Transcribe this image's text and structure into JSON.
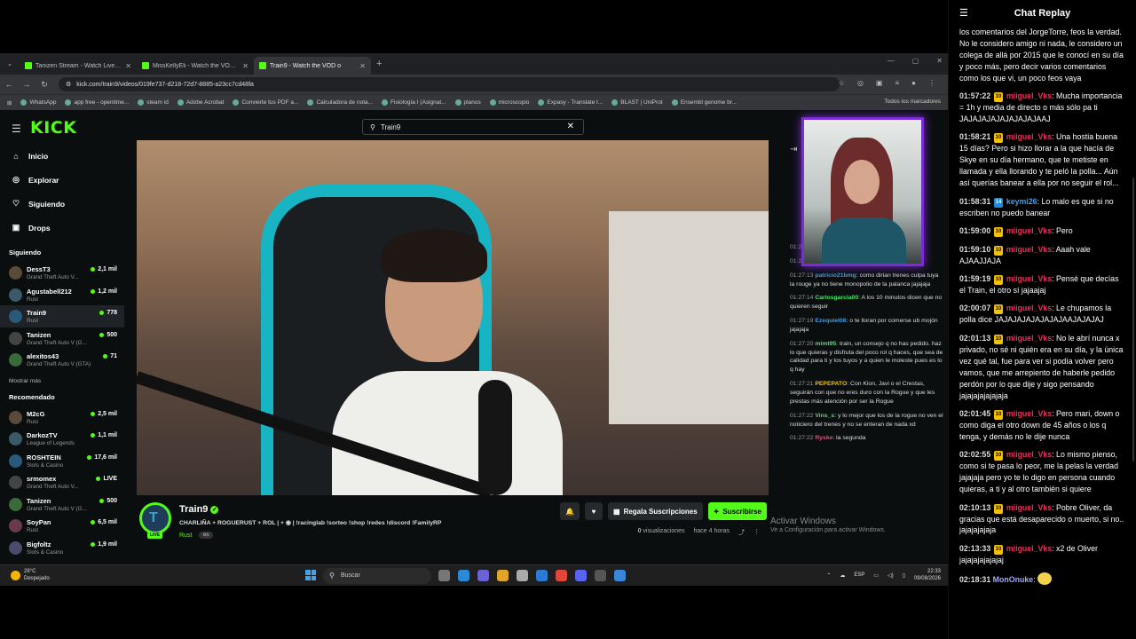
{
  "browser": {
    "tabs": [
      {
        "title": "Tanizen Stream - Watch Live on",
        "active": false
      },
      {
        "title": "MissKellyEli - Watch the VOD o",
        "active": false
      },
      {
        "title": "Train9 - Watch the VOD o",
        "active": true
      }
    ],
    "url": "kick.com/train9/videos/019fe737-d218-72d7-8885-a23cc7cd48fa",
    "bookmarks": [
      "WhatsApp",
      "app free - opentime...",
      "steam id",
      "Adobe Acrobat",
      "Convierte tus PDF a...",
      "Calculadora de nota...",
      "Fisiología I (Asignat...",
      "planos",
      "microscopio",
      "Expasy - Translate t...",
      "BLAST | UniProt",
      "Ensembl genome br..."
    ],
    "bookmarks_right": "Todos los marcadores"
  },
  "kick": {
    "logo": "KICK",
    "search_value": "Train9",
    "nav": [
      {
        "label": "Inicio",
        "icon": "home-icon"
      },
      {
        "label": "Explorar",
        "icon": "compass-icon"
      },
      {
        "label": "Siguiendo",
        "icon": "heart-icon"
      },
      {
        "label": "Drops",
        "icon": "gift-icon"
      }
    ],
    "following_title": "Siguiendo",
    "following": [
      {
        "name": "DessT3",
        "game": "Grand Theft Auto V...",
        "viewers": "2,1 mil"
      },
      {
        "name": "Agustabell212",
        "game": "Rust",
        "viewers": "1,2 mil"
      },
      {
        "name": "Train9",
        "game": "Rust",
        "viewers": "778"
      },
      {
        "name": "Tanizen",
        "game": "Grand Theft Auto V (G...",
        "viewers": "500"
      },
      {
        "name": "alexitos43",
        "game": "Grand Theft Auto V (GTA)",
        "viewers": "71"
      }
    ],
    "show_more": "Mostrar más",
    "recommended_title": "Recomendado",
    "recommended": [
      {
        "name": "M2cG",
        "game": "Rust",
        "viewers": "2,5 mil"
      },
      {
        "name": "DarkozTV",
        "game": "League of Legends",
        "viewers": "1,1 mil"
      },
      {
        "name": "ROSHTEIN",
        "game": "Slots & Casino",
        "viewers": "17,6 mil"
      },
      {
        "name": "srmomex",
        "game": "Grand Theft Auto V...",
        "viewers": "LIVE"
      },
      {
        "name": "Tanizen",
        "game": "Grand Theft Auto V (G...",
        "viewers": "500"
      },
      {
        "name": "SoyPan",
        "game": "Rust",
        "viewers": "6,5 mil"
      },
      {
        "name": "Bigfoltz",
        "game": "Slots & Casino",
        "viewers": "1,9 mil"
      }
    ],
    "channel": {
      "name": "Train9",
      "live_badge": "LIVE",
      "title": "CHARLIÑA + ROGUERUST + ROL | + ◉ | !racinglab !sorteo !shop !redes !discord !FamilyRP",
      "category": "Rust",
      "language": "es",
      "gift_subs": "Regala Suscripciones",
      "subscribe": "Suscribirse",
      "views_count": "0",
      "views_label": "visualizaciones",
      "ago": "hace 4 horas"
    },
    "overlay_chat": [
      {
        "ts": "01:27:11",
        "user": "L3G3ND4R104510",
        "color": "#4de36b",
        "text": "no aguantan"
      },
      {
        "ts": "01:27:13",
        "user": "Sirobe",
        "color": "#e84f7a",
        "text": "Pos a mi me molaria la vrd"
      },
      {
        "ts": "01:27:13",
        "user": "patricio21bmg",
        "color": "#36a3e8",
        "text": "como dirian trenes culpa tuya la rouge ya no tiene monopolio de la palanca jajajaja"
      },
      {
        "ts": "01:27:14",
        "user": "Carlosgarcia00",
        "color": "#4de36b",
        "text": "A los 10 minutos dicen que no quieren seguir"
      },
      {
        "ts": "01:27:19",
        "user": "Ezequiel06",
        "color": "#36a3e8",
        "text": "o te lloran por comerse ub mojón jajajaja"
      },
      {
        "ts": "01:27:20",
        "user": "mimt95",
        "color": "#4de36b",
        "text": "train, un consejo q no has pedido. haz lo que quieras y disfruta del poco rol q haces, que sea de calidad para ti y los tuyos y a quien le moleste pues es lo q hay"
      },
      {
        "ts": "01:27:21",
        "user": "PEPEPATO",
        "color": "#f2c200",
        "text": "Con Kion, Javi o el Crestas, seguirán con que no eres duro con la Rogue y que les prestas más atención por ser la Rogue"
      },
      {
        "ts": "01:27:22",
        "user": "Vins_s",
        "color": "#4de36b",
        "text": "y lo mejor que los de la rogue no ven el noticiero del trenes y no se enteran de nada xd"
      },
      {
        "ts": "01:27:22",
        "user": "Ryske",
        "color": "#e84f7a",
        "text": "la segunda"
      }
    ],
    "watermark_title": "Activar Windows",
    "watermark_sub": "Ve a Configuración para activar Windows."
  },
  "taskbar": {
    "temp": "28°C",
    "weather": "Despejado",
    "search": "Buscar",
    "lang": "ESP",
    "time": "22:33",
    "date": "09/08/2026"
  },
  "chat_replay": {
    "title": "Chat Replay",
    "first_text": "los comentarios del JorgeTorre, feos la verdad. No le considero amigo ni nada, le considero un colega de allá por 2015 que le conocí en su día y poco más, pero decir varios comentarios como los que vi, un poco feos vaya",
    "messages": [
      {
        "ts": "01:57:22",
        "badge": "10",
        "user": "miiguel_Vks",
        "color": "#e8315c",
        "text": "Mucha importancia = 1h y media de directo o más sólo pa ti JAJAJAJAJAJAJAJAJAAJ"
      },
      {
        "ts": "01:58:21",
        "badge": "10",
        "user": "miiguel_Vks",
        "color": "#e8315c",
        "text": "Una hostia buena 15 días? Pero si hizo llorar a la que hacía de Skye en su día hermano, que te metiste en llamada y ella llorando y te peló la polla... Aún así querías banear a ella por no seguir el rol..."
      },
      {
        "ts": "01:58:31",
        "badge": "14",
        "user": "keymi26",
        "color": "#3aa0f0",
        "text": "Lo malo es que si no escriben no puedo banear"
      },
      {
        "ts": "01:59:00",
        "badge": "10",
        "user": "miiguel_Vks",
        "color": "#e8315c",
        "text": "Pero"
      },
      {
        "ts": "01:59:10",
        "badge": "10",
        "user": "miiguel_Vks",
        "color": "#e8315c",
        "text": "Aaah vale AJAAJJAJA"
      },
      {
        "ts": "01:59:19",
        "badge": "10",
        "user": "miiguel_Vks",
        "color": "#e8315c",
        "text": "Pensé que decías el Train, el otro sí jajaajaj"
      },
      {
        "ts": "02:00:07",
        "badge": "10",
        "user": "miiguel_Vks",
        "color": "#e8315c",
        "text": "Le chupamos la polla dice JAJAJAJAJAJAJAJAAJAJAJAJ"
      },
      {
        "ts": "02:01:13",
        "badge": "10",
        "user": "miiguel_Vks",
        "color": "#e8315c",
        "text": "No le abrí nunca x privado, no sé ni quién era en su día, y la única vez qué tal, fue para ver si podía volver pero vamos, que me arrepiento de haberle pedido perdón por lo que dije y sigo pensando jajajajajajajaja"
      },
      {
        "ts": "02:01:45",
        "badge": "10",
        "user": "miiguel_Vks",
        "color": "#e8315c",
        "text": "Pero mari, down o como diga el otro down de 45 años o los q tenga, y demás no le dije nunca"
      },
      {
        "ts": "02:02:55",
        "badge": "10",
        "user": "miiguel_Vks",
        "color": "#e8315c",
        "text": "Lo mismo pienso, como si te pasa lo peor, me la pelas la verdad jajajaja pero yo te lo digo en persona cuando quieras, a ti y al otro también si quiere"
      },
      {
        "ts": "02:10:13",
        "badge": "10",
        "user": "miiguel_Vks",
        "color": "#e8315c",
        "text": "Pobre Oliver, da gracias que está desaparecido o muerto, si no.. jajajajajaja"
      },
      {
        "ts": "02:13:33",
        "badge": "10",
        "user": "miiguel_Vks",
        "color": "#e8315c",
        "text": "x2 de Oliver jajajajajajajaj"
      },
      {
        "ts": "02:18:31",
        "badge": "",
        "user": "MonOnuke",
        "color": "#9fa8ff",
        "text": "",
        "emote": true
      }
    ]
  }
}
